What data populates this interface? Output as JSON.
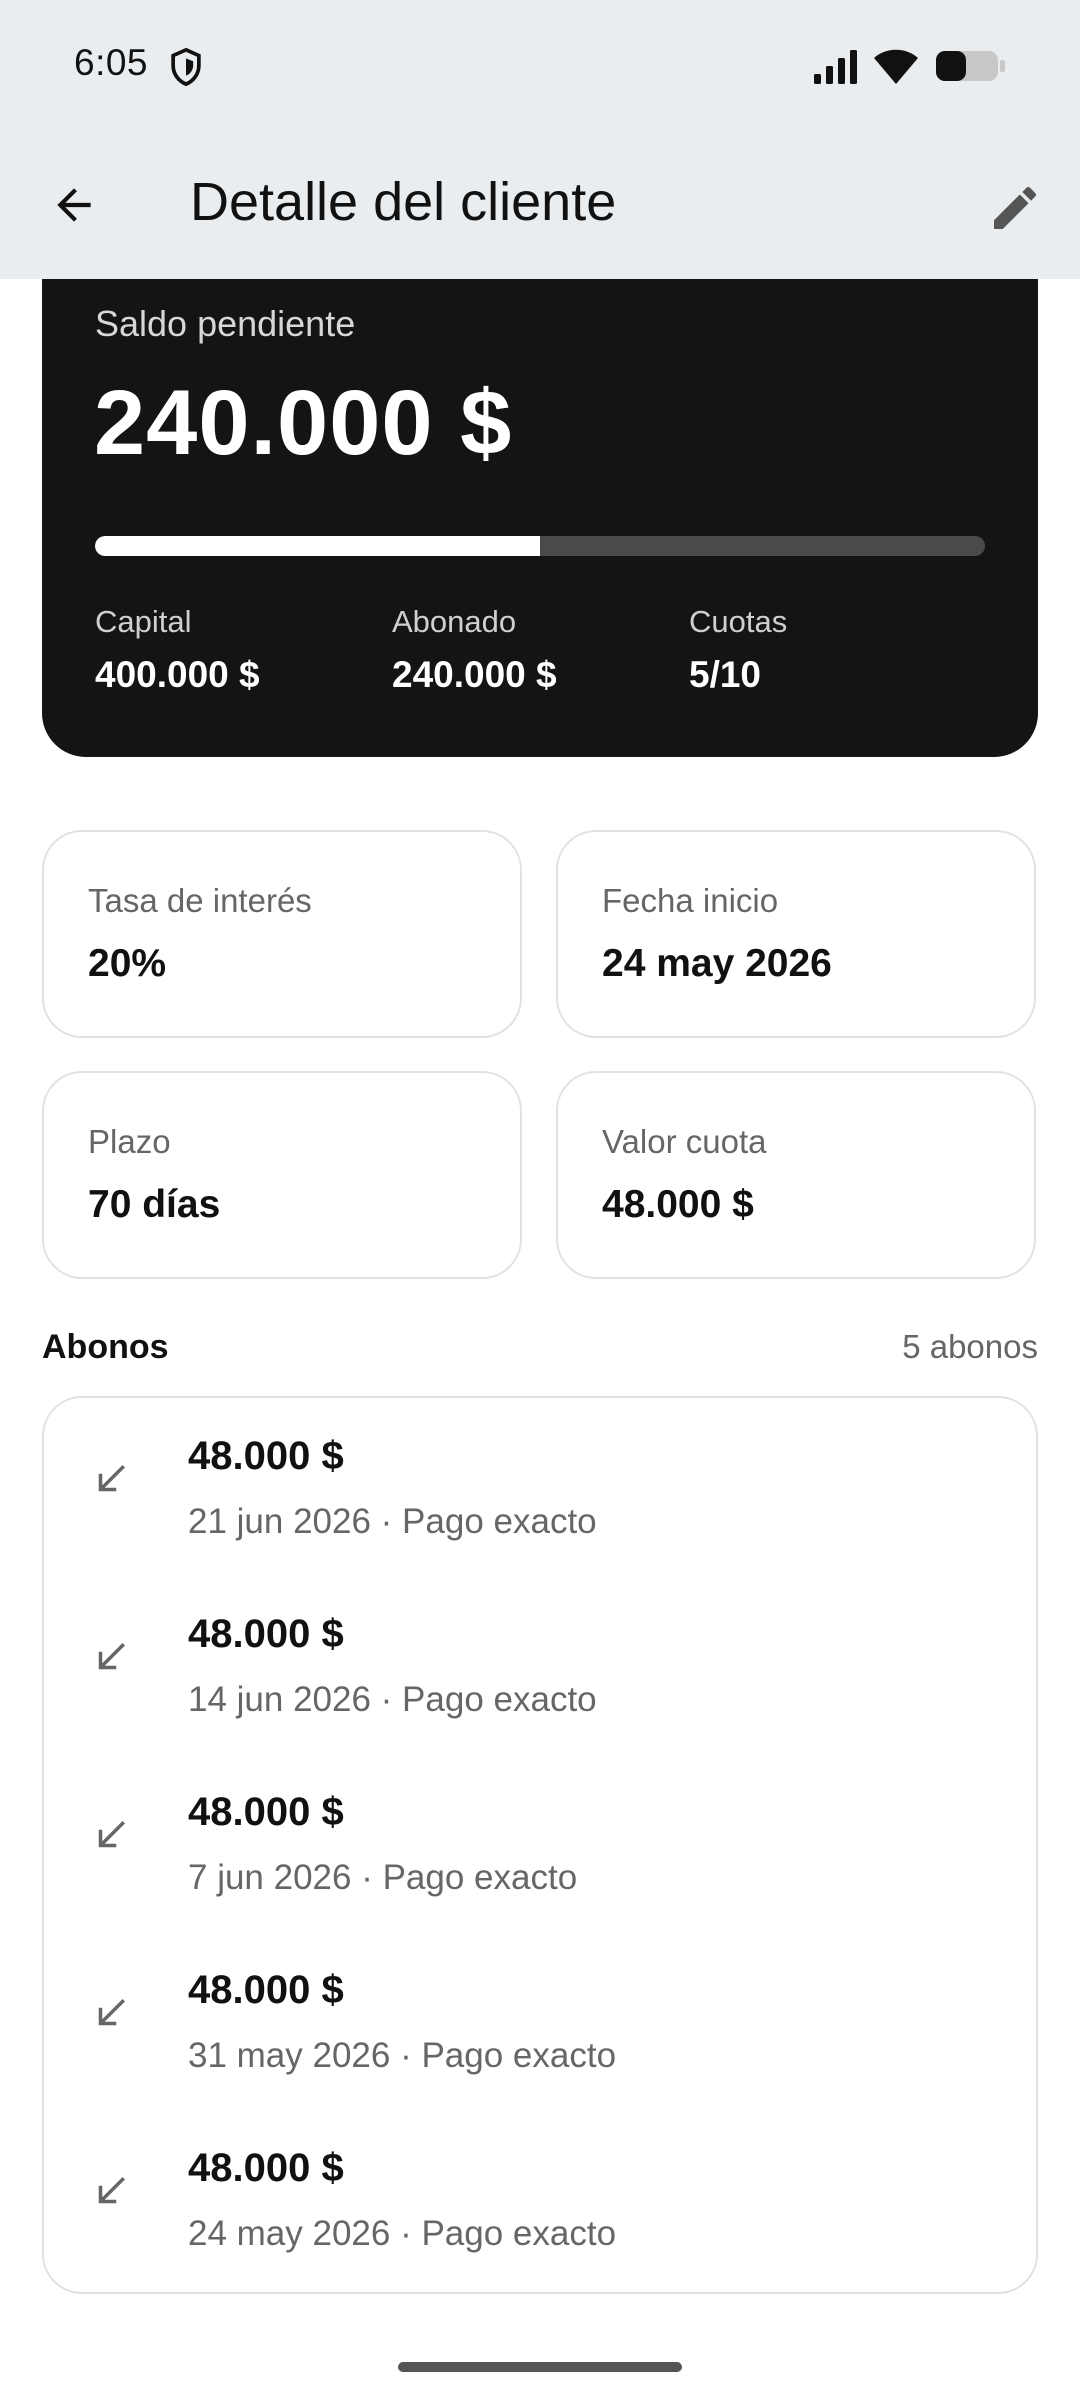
{
  "status_bar": {
    "time": "6:05",
    "icons": [
      "shield-icon",
      "signal-icon",
      "wifi-icon",
      "battery-icon"
    ]
  },
  "app_bar": {
    "title": "Detalle del cliente",
    "back_icon": "arrow-back-icon",
    "edit_icon": "pencil-icon"
  },
  "balance": {
    "label": "Saldo pendiente",
    "amount": "240.000 $",
    "progress_fraction": 0.5,
    "stats": [
      {
        "label": "Capital",
        "value": "400.000 $"
      },
      {
        "label": "Abonado",
        "value": "240.000 $"
      },
      {
        "label": "Cuotas",
        "value": "5/10"
      }
    ]
  },
  "info": [
    {
      "label": "Tasa de interés",
      "value": "20%"
    },
    {
      "label": "Fecha inicio",
      "value": "24 may 2026"
    },
    {
      "label": "Plazo",
      "value": "70 días"
    },
    {
      "label": "Valor cuota",
      "value": "48.000 $"
    }
  ],
  "payments_section": {
    "title": "Abonos",
    "count": "5 abonos",
    "items": [
      {
        "amount": "48.000 $",
        "meta": "21 jun 2026 · Pago exacto"
      },
      {
        "amount": "48.000 $",
        "meta": "14 jun 2026 · Pago exacto"
      },
      {
        "amount": "48.000 $",
        "meta": "7 jun 2026 · Pago exacto"
      },
      {
        "amount": "48.000 $",
        "meta": "31 may 2026 · Pago exacto"
      },
      {
        "amount": "48.000 $",
        "meta": "24 may 2026 · Pago exacto"
      }
    ]
  },
  "colors": {
    "card_dark": "#141414",
    "app_bar_bg": "#e9edf0",
    "muted_text": "#666666",
    "border": "#e2e2e2"
  }
}
